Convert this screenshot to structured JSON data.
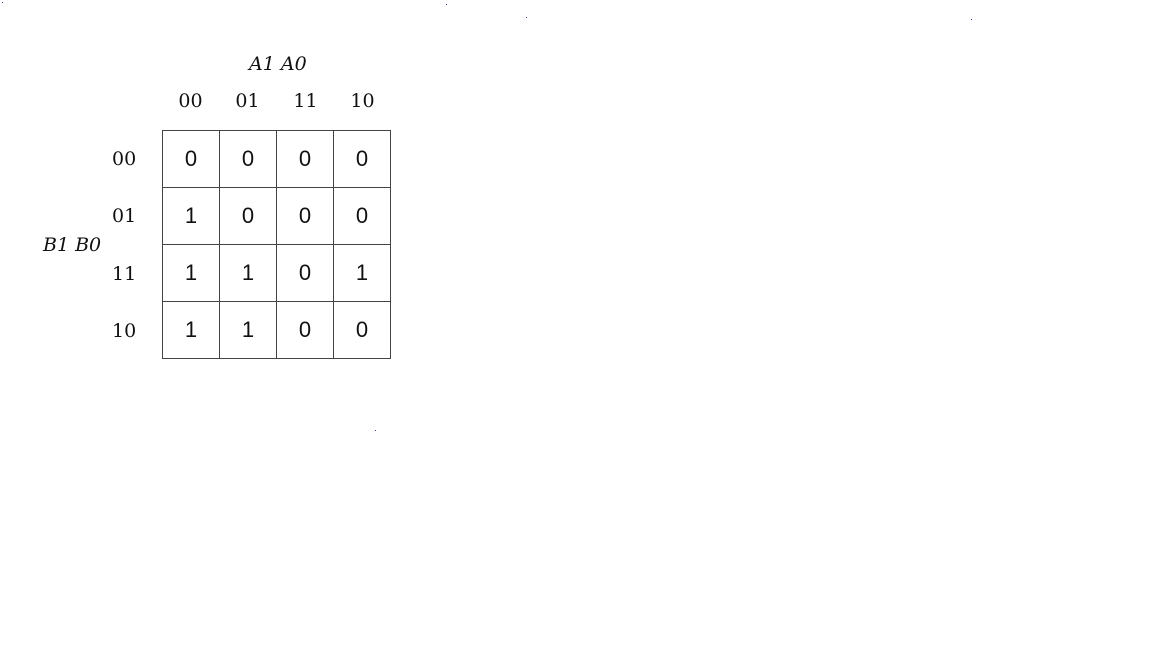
{
  "kmap": {
    "column_variables": "A1 A0",
    "row_variables": "B1 B0",
    "column_codes": [
      "00",
      "01",
      "11",
      "10"
    ],
    "row_codes": [
      "00",
      "01",
      "11",
      "10"
    ],
    "cells": [
      [
        "0",
        "0",
        "0",
        "0"
      ],
      [
        "1",
        "0",
        "0",
        "0"
      ],
      [
        "1",
        "1",
        "0",
        "1"
      ],
      [
        "1",
        "1",
        "0",
        "0"
      ]
    ]
  }
}
